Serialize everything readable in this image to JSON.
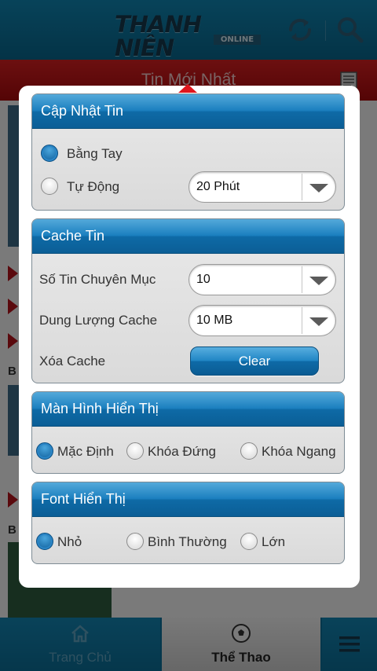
{
  "header": {
    "logo_main": "THANH NIÊN",
    "logo_sub": "ONLINE",
    "refresh_icon": "refresh-icon",
    "search_icon": "search-icon"
  },
  "section": {
    "title": "Tin Mới Nhất",
    "menu_icon": "list-icon"
  },
  "background_letters": [
    "B",
    "B"
  ],
  "settings": {
    "update": {
      "title": "Cập Nhật Tin",
      "manual_label": "Bằng Tay",
      "manual_checked": true,
      "auto_label": "Tự Động",
      "auto_checked": false,
      "interval_value": "20 Phút"
    },
    "cache": {
      "title": "Cache Tin",
      "items_label": "Số Tin Chuyên Mục",
      "items_value": "10",
      "size_label": "Dung Lượng Cache",
      "size_value": "10 MB",
      "clear_label": "Xóa Cache",
      "clear_button": "Clear"
    },
    "display": {
      "title": "Màn Hình Hiển Thị",
      "options": [
        {
          "label": "Mặc Định",
          "checked": true
        },
        {
          "label": "Khóa Đứng",
          "checked": false
        },
        {
          "label": "Khóa Ngang",
          "checked": false
        }
      ]
    },
    "font": {
      "title": "Font Hiển Thị",
      "options": [
        {
          "label": "Nhỏ",
          "checked": true
        },
        {
          "label": "Bình Thường",
          "checked": false
        },
        {
          "label": "Lớn",
          "checked": false
        }
      ]
    }
  },
  "tabs": {
    "home": "Trang Chủ",
    "sport": "Thể Thao",
    "home_icon": "home-icon",
    "sport_icon": "soccer-ball-icon",
    "menu_icon": "hamburger-menu-icon",
    "active": "sport"
  },
  "colors": {
    "header_blue": "#0b6f98",
    "section_red": "#c41418",
    "accent_blue": "#1b7fbf"
  }
}
